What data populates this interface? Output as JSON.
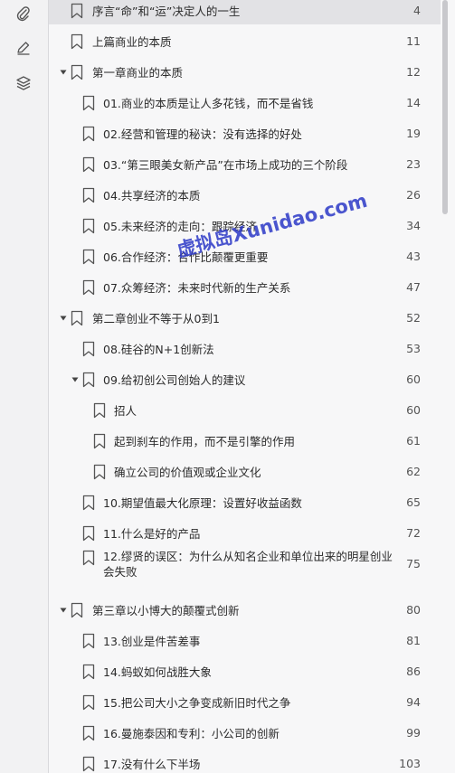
{
  "watermark": "虚拟岛Xunidao.com",
  "rail_icons": [
    "paperclip-icon",
    "pen-icon",
    "layers-icon"
  ],
  "toc": [
    {
      "label": "序言“命”和“运”决定人的一生",
      "page": "4",
      "level": 0,
      "selected": true
    },
    {
      "label": "上篇商业的本质",
      "page": "11",
      "level": 0
    },
    {
      "label": "第一章商业的本质",
      "page": "12",
      "level": 0,
      "expanded": true
    },
    {
      "label": "01.商业的本质是让人多花钱，而不是省钱",
      "page": "14",
      "level": 1
    },
    {
      "label": "02.经营和管理的秘诀：没有选择的好处",
      "page": "19",
      "level": 1
    },
    {
      "label": "03.“第三眼美女新产品”在市场上成功的三个阶段",
      "page": "23",
      "level": 1
    },
    {
      "label": "04.共享经济的本质",
      "page": "26",
      "level": 1
    },
    {
      "label": "05.未来经济的走向：跟踪经济",
      "page": "34",
      "level": 1
    },
    {
      "label": "06.合作经济：合作比颠覆更重要",
      "page": "43",
      "level": 1
    },
    {
      "label": "07.众筹经济：未来时代新的生产关系",
      "page": "47",
      "level": 1
    },
    {
      "label": "第二章创业不等于从0到1",
      "page": "52",
      "level": 0,
      "expanded": true
    },
    {
      "label": "08.硅谷的N+1创新法",
      "page": "53",
      "level": 1
    },
    {
      "label": "09.给初创公司创始人的建议",
      "page": "60",
      "level": 1,
      "expanded": true
    },
    {
      "label": "招人",
      "page": "60",
      "level": 2
    },
    {
      "label": "起到刹车的作用，而不是引擎的作用",
      "page": "61",
      "level": 2
    },
    {
      "label": "确立公司的价值观或企业文化",
      "page": "62",
      "level": 2
    },
    {
      "label": "10.期望值最大化原理：设置好收益函数",
      "page": "65",
      "level": 1
    },
    {
      "label": "11.什么是好的产品",
      "page": "72",
      "level": 1
    },
    {
      "label": "12.缪贤的误区：为什么从知名企业和单位出来的明星创业会失败",
      "page": "75",
      "level": 1,
      "tall": true
    },
    {
      "label": "第三章以小博大的颠覆式创新",
      "page": "80",
      "level": 0,
      "expanded": true
    },
    {
      "label": "13.创业是件苦差事",
      "page": "81",
      "level": 1
    },
    {
      "label": "14.蚂蚁如何战胜大象",
      "page": "86",
      "level": 1
    },
    {
      "label": "15.把公司大小之争变成新旧时代之争",
      "page": "94",
      "level": 1
    },
    {
      "label": "16.曼施泰因和专利：小公司的创新",
      "page": "99",
      "level": 1
    },
    {
      "label": "17.没有什么下半场",
      "page": "103",
      "level": 1
    }
  ]
}
